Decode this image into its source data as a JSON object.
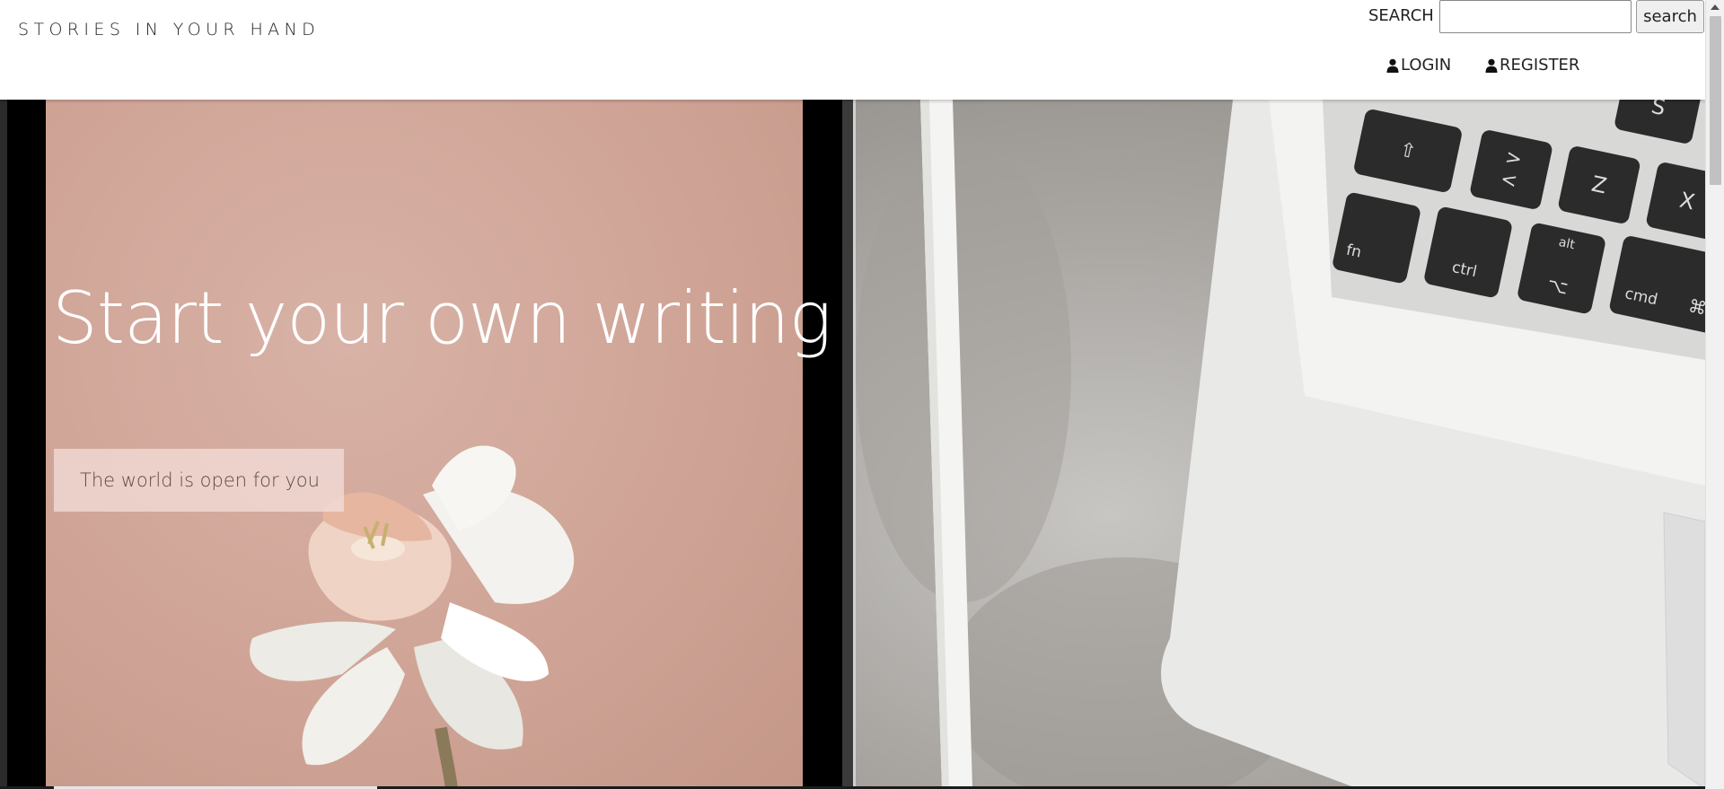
{
  "header": {
    "brand": "STORIES IN YOUR HAND",
    "search_label": "SEARCH",
    "search_placeholder": "",
    "search_button": "search",
    "nav": {
      "login": "LOGIN",
      "register": "REGISTER"
    }
  },
  "hero": {
    "title": "Start your own writing",
    "tagline": "The world is open for you"
  },
  "images": {
    "left": "pink-background-with-white-daffodil",
    "right": "laptop-keyboard-and-stylus-on-concrete"
  },
  "keyboard_keys": [
    "S",
    "⇧",
    ">",
    "<",
    "Z",
    "X",
    "fn",
    "ctrl",
    "alt",
    "⌥",
    "cmd",
    "⌘"
  ],
  "colors": {
    "header_bg": "#ffffff",
    "text": "#222222",
    "hero_text": "#ffffff",
    "tag_bg": "#f5e1dc",
    "pink_panel": "#cfa496"
  }
}
